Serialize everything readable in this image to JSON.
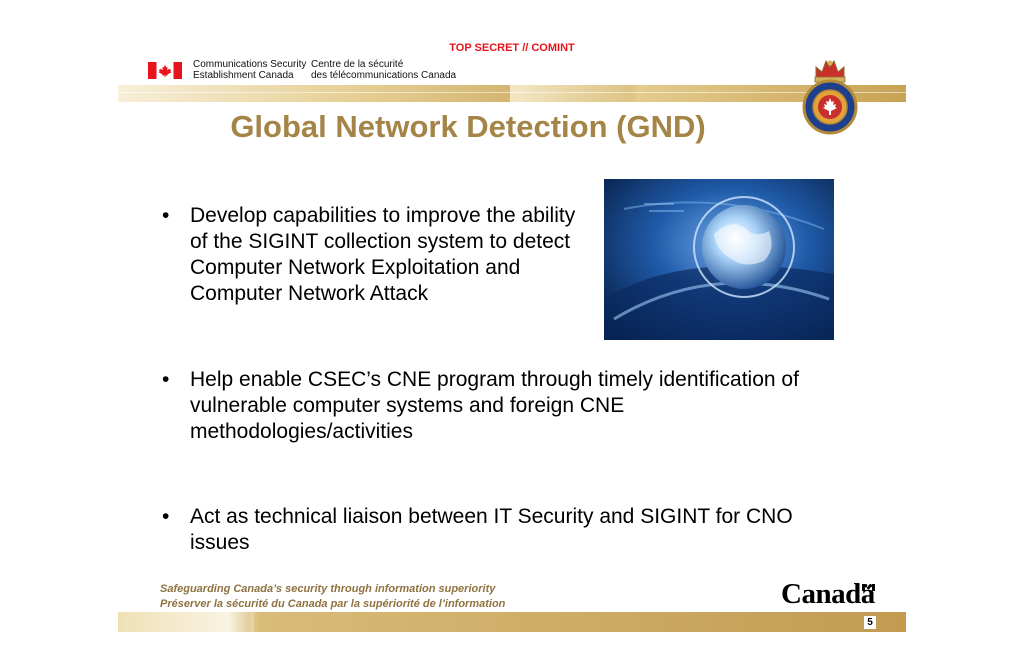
{
  "header": {
    "classification": "TOP SECRET // COMINT",
    "agency_en_line1": "Communications Security",
    "agency_en_line2": "Establishment Canada",
    "agency_fr_line1": "Centre de la sécurité",
    "agency_fr_line2": "des télécommunications Canada"
  },
  "slide": {
    "title": "Global Network Detection (GND)",
    "bullets": [
      "Develop capabilities to improve the ability of the SIGINT collection system to detect Computer Network Exploitation and Computer Network Attack",
      "Help enable CSEC’s CNE program through timely identification of vulnerable computer systems and foreign CNE methodologies/activities",
      "Act as technical liaison between IT Security and SIGINT for CNO issues"
    ],
    "bullet_symbol": "•",
    "image_alt": "globe-graphic"
  },
  "footer": {
    "tagline_en": "Safeguarding Canada’s security through information superiority",
    "tagline_fr": "Préserver la sécurité du Canada par la supériorité de l’information",
    "wordmark": "Canadä",
    "page_number": "5"
  },
  "colors": {
    "classification": "#e8141b",
    "title": "#a48447",
    "tagline": "#8f7240",
    "flag_red": "#e8141b",
    "bar_gold": "#c9a65b"
  },
  "icons": [
    "canada-flag-icon",
    "csec-crest-icon",
    "canada-wordmark-flag-icon"
  ]
}
